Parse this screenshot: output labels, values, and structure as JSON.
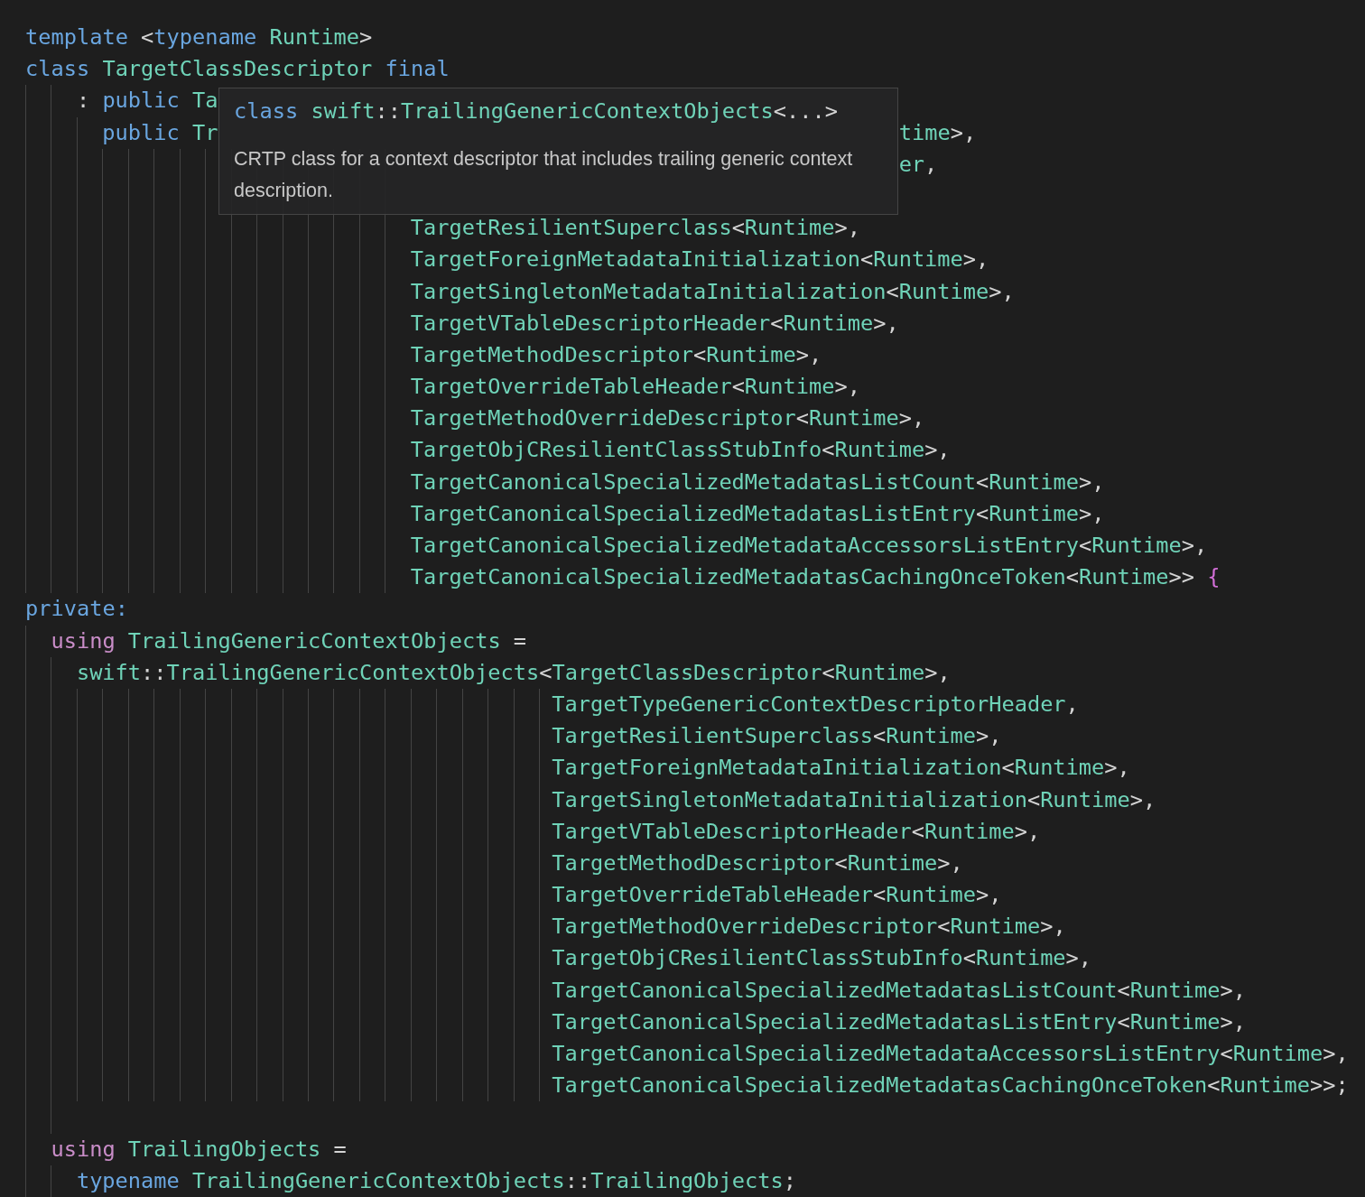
{
  "editor": {
    "lines": [
      {
        "kind": "top",
        "tokens": [
          {
            "kind": "keyword",
            "text": "template "
          },
          {
            "kind": "punct",
            "text": "<"
          },
          {
            "kind": "keyword",
            "text": "typename "
          },
          {
            "kind": "type",
            "text": "Runtime"
          },
          {
            "kind": "punct",
            "text": ">"
          }
        ]
      },
      {
        "kind": "top",
        "tokens": [
          {
            "kind": "keyword",
            "text": "class "
          },
          {
            "kind": "type",
            "text": "TargetClassDescriptor "
          },
          {
            "kind": "keyword",
            "text": "final"
          }
        ]
      },
      {
        "kind": "base",
        "tokens": [
          {
            "kind": "punct",
            "text": ": "
          },
          {
            "kind": "keyword",
            "text": "public "
          },
          {
            "kind": "type",
            "text": "Ta"
          }
        ]
      },
      {
        "kind": "inner",
        "tokens": [
          {
            "kind": "keyword",
            "text": "public "
          },
          {
            "kind": "type",
            "text": "Tr"
          },
          {
            "kind": "covered"
          },
          {
            "kind": "type",
            "text": "time"
          },
          {
            "kind": "punct",
            "text": ">,"
          }
        ]
      },
      {
        "kind": "args",
        "tokens": [
          {
            "kind": "covered"
          },
          {
            "kind": "type",
            "text": "er"
          },
          {
            "kind": "punct",
            "text": ","
          }
        ]
      },
      {
        "kind": "args"
      },
      {
        "kind": "args",
        "tokens": [
          {
            "kind": "type",
            "text": "TargetResilientSuperclass"
          },
          {
            "kind": "punct",
            "text": "<"
          },
          {
            "kind": "type",
            "text": "Runtime"
          },
          {
            "kind": "punct",
            "text": ">,"
          }
        ]
      },
      {
        "kind": "args",
        "tokens": [
          {
            "kind": "type",
            "text": "TargetForeignMetadataInitialization"
          },
          {
            "kind": "punct",
            "text": "<"
          },
          {
            "kind": "type",
            "text": "Runtime"
          },
          {
            "kind": "punct",
            "text": ">,"
          }
        ]
      },
      {
        "kind": "args",
        "tokens": [
          {
            "kind": "type",
            "text": "TargetSingletonMetadataInitialization"
          },
          {
            "kind": "punct",
            "text": "<"
          },
          {
            "kind": "type",
            "text": "Runtime"
          },
          {
            "kind": "punct",
            "text": ">,"
          }
        ]
      },
      {
        "kind": "args",
        "tokens": [
          {
            "kind": "type",
            "text": "TargetVTableDescriptorHeader"
          },
          {
            "kind": "punct",
            "text": "<"
          },
          {
            "kind": "type",
            "text": "Runtime"
          },
          {
            "kind": "punct",
            "text": ">,"
          }
        ]
      },
      {
        "kind": "args",
        "tokens": [
          {
            "kind": "type",
            "text": "TargetMethodDescriptor"
          },
          {
            "kind": "punct",
            "text": "<"
          },
          {
            "kind": "type",
            "text": "Runtime"
          },
          {
            "kind": "punct",
            "text": ">,"
          }
        ]
      },
      {
        "kind": "args",
        "tokens": [
          {
            "kind": "type",
            "text": "TargetOverrideTableHeader"
          },
          {
            "kind": "punct",
            "text": "<"
          },
          {
            "kind": "type",
            "text": "Runtime"
          },
          {
            "kind": "punct",
            "text": ">,"
          }
        ]
      },
      {
        "kind": "args",
        "tokens": [
          {
            "kind": "type",
            "text": "TargetMethodOverrideDescriptor"
          },
          {
            "kind": "punct",
            "text": "<"
          },
          {
            "kind": "type",
            "text": "Runtime"
          },
          {
            "kind": "punct",
            "text": ">,"
          }
        ]
      },
      {
        "kind": "args",
        "tokens": [
          {
            "kind": "type",
            "text": "TargetObjCResilientClassStubInfo"
          },
          {
            "kind": "punct",
            "text": "<"
          },
          {
            "kind": "type",
            "text": "Runtime"
          },
          {
            "kind": "punct",
            "text": ">,"
          }
        ]
      },
      {
        "kind": "args",
        "tokens": [
          {
            "kind": "type",
            "text": "TargetCanonicalSpecializedMetadatasListCount"
          },
          {
            "kind": "punct",
            "text": "<"
          },
          {
            "kind": "type",
            "text": "Runtime"
          },
          {
            "kind": "punct",
            "text": ">,"
          }
        ]
      },
      {
        "kind": "args",
        "tokens": [
          {
            "kind": "type",
            "text": "TargetCanonicalSpecializedMetadatasListEntry"
          },
          {
            "kind": "punct",
            "text": "<"
          },
          {
            "kind": "type",
            "text": "Runtime"
          },
          {
            "kind": "punct",
            "text": ">,"
          }
        ]
      },
      {
        "kind": "args",
        "tokens": [
          {
            "kind": "type",
            "text": "TargetCanonicalSpecializedMetadataAccessorsListEntry"
          },
          {
            "kind": "punct",
            "text": "<"
          },
          {
            "kind": "type",
            "text": "Runtime"
          },
          {
            "kind": "punct",
            "text": ">,"
          }
        ]
      },
      {
        "kind": "args",
        "tokens": [
          {
            "kind": "type",
            "text": "TargetCanonicalSpecializedMetadatasCachingOnceToken"
          },
          {
            "kind": "punct",
            "text": "<"
          },
          {
            "kind": "type",
            "text": "Runtime"
          },
          {
            "kind": "punct",
            "text": ">> "
          },
          {
            "kind": "brace",
            "text": "{"
          }
        ]
      },
      {
        "kind": "top",
        "tokens": [
          {
            "kind": "keyword",
            "text": "private:"
          }
        ]
      },
      {
        "kind": "member",
        "tokens": [
          {
            "kind": "control",
            "text": "using "
          },
          {
            "kind": "type",
            "text": "TrailingGenericContextObjects"
          },
          {
            "kind": "punct",
            "text": " ="
          }
        ]
      },
      {
        "kind": "base",
        "tokens": [
          {
            "kind": "type",
            "text": "swift"
          },
          {
            "kind": "punct",
            "text": "::"
          },
          {
            "kind": "type",
            "text": "TrailingGenericContextObjects"
          },
          {
            "kind": "punct",
            "text": "<"
          },
          {
            "kind": "type",
            "text": "TargetClassDescriptor"
          },
          {
            "kind": "punct",
            "text": "<"
          },
          {
            "kind": "type",
            "text": "Runtime"
          },
          {
            "kind": "punct",
            "text": ">,"
          }
        ]
      },
      {
        "kind": "wide",
        "tokens": [
          {
            "kind": "type",
            "text": "TargetTypeGenericContextDescriptorHeader"
          },
          {
            "kind": "punct",
            "text": ","
          }
        ]
      },
      {
        "kind": "wide",
        "tokens": [
          {
            "kind": "type",
            "text": "TargetResilientSuperclass"
          },
          {
            "kind": "punct",
            "text": "<"
          },
          {
            "kind": "type",
            "text": "Runtime"
          },
          {
            "kind": "punct",
            "text": ">,"
          }
        ]
      },
      {
        "kind": "wide",
        "tokens": [
          {
            "kind": "type",
            "text": "TargetForeignMetadataInitialization"
          },
          {
            "kind": "punct",
            "text": "<"
          },
          {
            "kind": "type",
            "text": "Runtime"
          },
          {
            "kind": "punct",
            "text": ">,"
          }
        ]
      },
      {
        "kind": "wide",
        "tokens": [
          {
            "kind": "type",
            "text": "TargetSingletonMetadataInitialization"
          },
          {
            "kind": "punct",
            "text": "<"
          },
          {
            "kind": "type",
            "text": "Runtime"
          },
          {
            "kind": "punct",
            "text": ">,"
          }
        ]
      },
      {
        "kind": "wide",
        "tokens": [
          {
            "kind": "type",
            "text": "TargetVTableDescriptorHeader"
          },
          {
            "kind": "punct",
            "text": "<"
          },
          {
            "kind": "type",
            "text": "Runtime"
          },
          {
            "kind": "punct",
            "text": ">,"
          }
        ]
      },
      {
        "kind": "wide",
        "tokens": [
          {
            "kind": "type",
            "text": "TargetMethodDescriptor"
          },
          {
            "kind": "punct",
            "text": "<"
          },
          {
            "kind": "type",
            "text": "Runtime"
          },
          {
            "kind": "punct",
            "text": ">,"
          }
        ]
      },
      {
        "kind": "wide",
        "tokens": [
          {
            "kind": "type",
            "text": "TargetOverrideTableHeader"
          },
          {
            "kind": "punct",
            "text": "<"
          },
          {
            "kind": "type",
            "text": "Runtime"
          },
          {
            "kind": "punct",
            "text": ">,"
          }
        ]
      },
      {
        "kind": "wide",
        "tokens": [
          {
            "kind": "type",
            "text": "TargetMethodOverrideDescriptor"
          },
          {
            "kind": "punct",
            "text": "<"
          },
          {
            "kind": "type",
            "text": "Runtime"
          },
          {
            "kind": "punct",
            "text": ">,"
          }
        ]
      },
      {
        "kind": "wide",
        "tokens": [
          {
            "kind": "type",
            "text": "TargetObjCResilientClassStubInfo"
          },
          {
            "kind": "punct",
            "text": "<"
          },
          {
            "kind": "type",
            "text": "Runtime"
          },
          {
            "kind": "punct",
            "text": ">,"
          }
        ]
      },
      {
        "kind": "wide",
        "tokens": [
          {
            "kind": "type",
            "text": "TargetCanonicalSpecializedMetadatasListCount"
          },
          {
            "kind": "punct",
            "text": "<"
          },
          {
            "kind": "type",
            "text": "Runtime"
          },
          {
            "kind": "punct",
            "text": ">,"
          }
        ]
      },
      {
        "kind": "wide",
        "tokens": [
          {
            "kind": "type",
            "text": "TargetCanonicalSpecializedMetadatasListEntry"
          },
          {
            "kind": "punct",
            "text": "<"
          },
          {
            "kind": "type",
            "text": "Runtime"
          },
          {
            "kind": "punct",
            "text": ">,"
          }
        ]
      },
      {
        "kind": "wide",
        "tokens": [
          {
            "kind": "type",
            "text": "TargetCanonicalSpecializedMetadataAccessorsListEntry"
          },
          {
            "kind": "punct",
            "text": "<"
          },
          {
            "kind": "type",
            "text": "Runtime"
          },
          {
            "kind": "punct",
            "text": ">,"
          }
        ]
      },
      {
        "kind": "wide",
        "tokens": [
          {
            "kind": "type",
            "text": "TargetCanonicalSpecializedMetadatasCachingOnceToken"
          },
          {
            "kind": "punct",
            "text": "<"
          },
          {
            "kind": "type",
            "text": "Runtime"
          },
          {
            "kind": "punct",
            "text": ">>;"
          }
        ]
      },
      {
        "kind": "base"
      },
      {
        "kind": "member",
        "tokens": [
          {
            "kind": "control",
            "text": "using "
          },
          {
            "kind": "type",
            "text": "TrailingObjects"
          },
          {
            "kind": "punct",
            "text": " ="
          }
        ]
      },
      {
        "kind": "base",
        "tokens": [
          {
            "kind": "keyword",
            "text": "typename "
          },
          {
            "kind": "type",
            "text": "TrailingGenericContextObjects"
          },
          {
            "kind": "punct",
            "text": "::"
          },
          {
            "kind": "type",
            "text": "TrailingObjects"
          },
          {
            "kind": "punct",
            "text": ";"
          }
        ]
      }
    ]
  },
  "tooltip": {
    "signature": [
      {
        "kind": "keyword",
        "text": "class "
      },
      {
        "kind": "type",
        "text": "swift"
      },
      {
        "kind": "punct",
        "text": "::"
      },
      {
        "kind": "type",
        "text": "TrailingGenericContextObjects"
      },
      {
        "kind": "punct",
        "text": "<...>"
      }
    ],
    "description": "CRTP class for a context descriptor that includes trailing generic context description."
  }
}
